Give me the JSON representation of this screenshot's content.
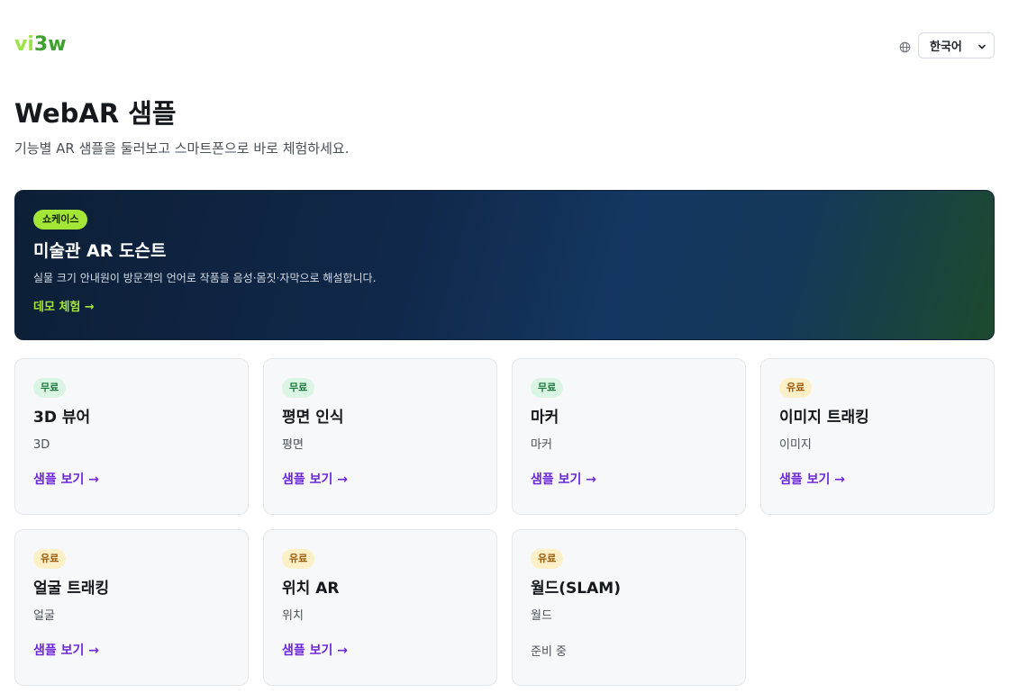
{
  "header": {
    "logo_part1": "vi",
    "logo_part2": "3w",
    "language": "한국어"
  },
  "page": {
    "title": "WebAR 샘플",
    "subtitle": "기능별 AR 샘플을 둘러보고 스마트폰으로 바로 체험하세요."
  },
  "hero": {
    "badge": "쇼케이스",
    "title": "미술관 AR 도슨트",
    "description": "실물 크기 안내원이 방문객의 언어로 작품을 음성·몸짓·자막으로 해설합니다.",
    "link": "데모 체험 →"
  },
  "cards": [
    {
      "badge": "무료",
      "title": "3D 뷰어",
      "desc": "3D",
      "link": "샘플 보기 →"
    },
    {
      "badge": "무료",
      "title": "평면 인식",
      "desc": "평면",
      "link": "샘플 보기 →"
    },
    {
      "badge": "무료",
      "title": "마커",
      "desc": "마커",
      "link": "샘플 보기 →"
    },
    {
      "badge": "유료",
      "title": "이미지 트래킹",
      "desc": "이미지",
      "link": "샘플 보기 →"
    },
    {
      "badge": "유료",
      "title": "얼굴 트래킹",
      "desc": "얼굴",
      "link": "샘플 보기 →"
    },
    {
      "badge": "유료",
      "title": "위치 AR",
      "desc": "위치",
      "link": "샘플 보기 →"
    },
    {
      "badge": "유료",
      "title": "월드(SLAM)",
      "desc": "월드",
      "status": "준비 중"
    }
  ],
  "colors": {
    "accent_green": "#a3e635",
    "link_purple": "#6d28d9",
    "free_badge_bg": "#daf5e4",
    "paid_badge_bg": "#fdefc6"
  }
}
